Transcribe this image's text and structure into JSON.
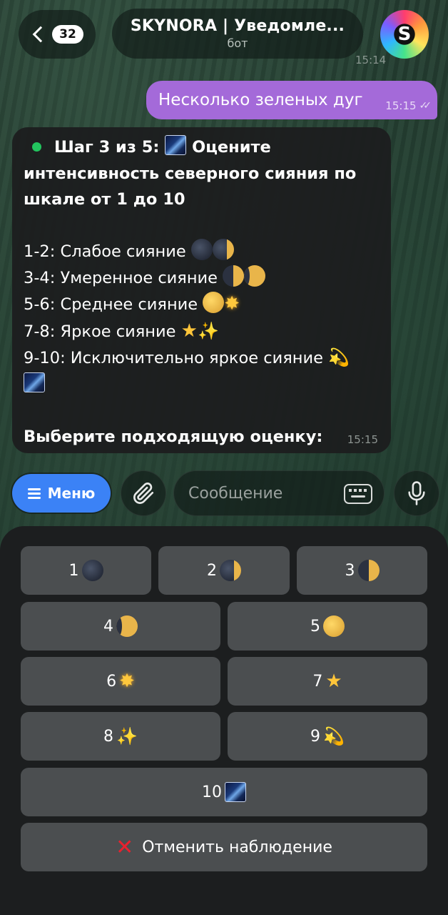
{
  "header": {
    "back_count": "32",
    "title": "SKYNORA | Уведомле...",
    "subtitle": "бот",
    "time_overlay": "15:14"
  },
  "outgoing_message": {
    "text": "Несколько зеленых дуг",
    "time": "15:15",
    "status": "read"
  },
  "incoming_message": {
    "title_line1": "Шаг 3 из 5:",
    "title_line1_end": "Оцените",
    "title_line2": "интенсивность северного сияния по",
    "title_line3": "шкале от 1 до 10",
    "scale": [
      {
        "text": "1-2: Слабое сияние",
        "icons": [
          "new-moon",
          "waxing-crescent-moon"
        ]
      },
      {
        "text": "3-4: Умеренное сияние",
        "icons": [
          "first-quarter-moon",
          "waxing-gibbous-moon"
        ]
      },
      {
        "text": "5-6: Среднее сияние",
        "icons": [
          "full-moon",
          "glowing-star"
        ]
      },
      {
        "text": "7-8: Яркое сияние",
        "icons": [
          "star",
          "sparkles"
        ]
      },
      {
        "text": "9-10: Исключительно яркое сияние",
        "icons": [
          "dizzy",
          "milky-way"
        ]
      }
    ],
    "prompt": "Выберите подходящую оценку:",
    "time": "15:15",
    "status_dot_color": "#22c55e"
  },
  "input_bar": {
    "menu_label": "Меню",
    "message_placeholder": "Сообщение"
  },
  "keyboard": {
    "buttons": [
      {
        "label": "1",
        "icon": "new-moon"
      },
      {
        "label": "2",
        "icon": "waxing-crescent-moon"
      },
      {
        "label": "3",
        "icon": "first-quarter-moon"
      },
      {
        "label": "4",
        "icon": "waxing-gibbous-moon"
      },
      {
        "label": "5",
        "icon": "full-moon"
      },
      {
        "label": "6",
        "icon": "glowing-star"
      },
      {
        "label": "7",
        "icon": "star"
      },
      {
        "label": "8",
        "icon": "sparkles"
      },
      {
        "label": "9",
        "icon": "dizzy"
      },
      {
        "label": "10",
        "icon": "milky-way"
      }
    ],
    "cancel_label": "Отменить наблюдение",
    "cancel_icon": "cross-mark"
  },
  "colors": {
    "accent_blue": "#3b82f6",
    "outgoing_bubble": "#a46ad9",
    "keyboard_button": "#4b4e50"
  }
}
